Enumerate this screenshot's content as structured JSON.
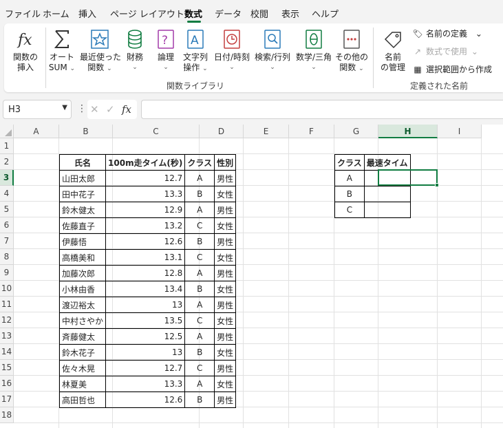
{
  "menu": {
    "items": [
      "ファイル",
      "ホーム",
      "挿入",
      "ページ レイアウト",
      "数式",
      "データ",
      "校閲",
      "表示",
      "ヘルプ"
    ],
    "active_index": 4
  },
  "ribbon": {
    "insert_function": [
      "関数の",
      "挿入"
    ],
    "autosum": [
      "オート",
      "SUM"
    ],
    "recent": [
      "最近使った",
      "関数"
    ],
    "financial": "財務",
    "logical": "論理",
    "text": [
      "文字列",
      "操作"
    ],
    "datetime": "日付/時刻",
    "lookup": "検索/行列",
    "math": "数学/三角",
    "more": [
      "その他の",
      "関数"
    ],
    "group_library": "関数ライブラリ",
    "name_manager": [
      "名前",
      "の管理"
    ],
    "define_name": "名前の定義",
    "use_in_formula": "数式で使用",
    "create_from_selection": "選択範囲から作成",
    "group_names": "定義された名前",
    "chevron": "⌄",
    "accent": "#107c41"
  },
  "formula_bar": {
    "name_box": "H3",
    "formula": "",
    "fx_label": "fx",
    "cancel": "✕",
    "enter": "✓",
    "dots": "⋮"
  },
  "grid": {
    "columns": [
      "A",
      "B",
      "C",
      "D",
      "E",
      "F",
      "G",
      "H",
      "I"
    ],
    "rows": [
      "1",
      "2",
      "3",
      "4",
      "5",
      "6",
      "7",
      "8",
      "9",
      "10",
      "11",
      "12",
      "13",
      "14",
      "15",
      "16",
      "17",
      "18"
    ],
    "selected_col": "H",
    "selected_row": "3"
  },
  "main_table": {
    "headers": [
      "氏名",
      "100m走タイム(秒)",
      "クラス",
      "性別"
    ],
    "rows": [
      [
        "山田太郎",
        "12.7",
        "A",
        "男性"
      ],
      [
        "田中花子",
        "13.3",
        "B",
        "女性"
      ],
      [
        "鈴木健太",
        "12.9",
        "A",
        "男性"
      ],
      [
        "佐藤直子",
        "13.2",
        "C",
        "女性"
      ],
      [
        "伊藤悟",
        "12.6",
        "B",
        "男性"
      ],
      [
        "高橋美和",
        "13.1",
        "C",
        "女性"
      ],
      [
        "加藤次郎",
        "12.8",
        "A",
        "男性"
      ],
      [
        "小林由香",
        "13.4",
        "B",
        "女性"
      ],
      [
        "渡辺裕太",
        "13",
        "A",
        "男性"
      ],
      [
        "中村さやか",
        "13.5",
        "C",
        "女性"
      ],
      [
        "斉藤健太",
        "12.5",
        "A",
        "男性"
      ],
      [
        "鈴木花子",
        "13",
        "B",
        "女性"
      ],
      [
        "佐々木晃",
        "12.7",
        "C",
        "男性"
      ],
      [
        "林夏美",
        "13.3",
        "A",
        "女性"
      ],
      [
        "高田哲也",
        "12.6",
        "B",
        "男性"
      ]
    ]
  },
  "summary_table": {
    "headers": [
      "クラス",
      "最速タイム"
    ],
    "rows": [
      [
        "A",
        ""
      ],
      [
        "B",
        ""
      ],
      [
        "C",
        ""
      ]
    ]
  }
}
